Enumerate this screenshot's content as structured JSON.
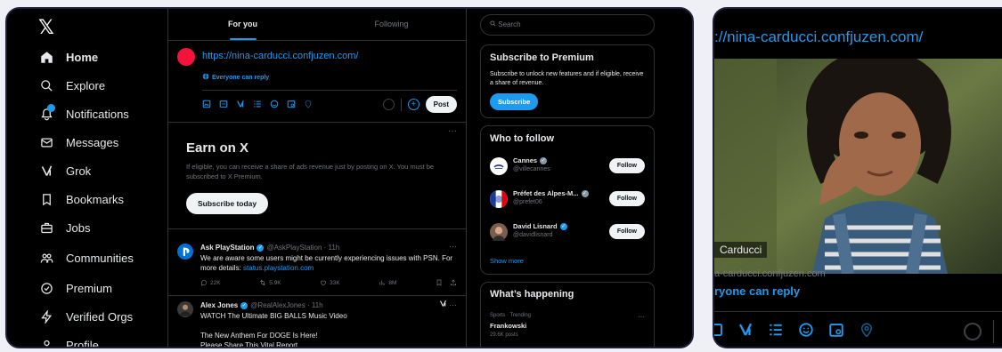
{
  "sidebar": {
    "logo": "𝕏",
    "items": [
      {
        "label": "Home",
        "icon": "home-icon"
      },
      {
        "label": "Explore",
        "icon": "search-icon"
      },
      {
        "label": "Notifications",
        "icon": "bell-icon"
      },
      {
        "label": "Messages",
        "icon": "envelope-icon"
      },
      {
        "label": "Grok",
        "icon": "grok-icon"
      },
      {
        "label": "Bookmarks",
        "icon": "bookmark-icon"
      },
      {
        "label": "Jobs",
        "icon": "briefcase-icon"
      },
      {
        "label": "Communities",
        "icon": "people-icon"
      },
      {
        "label": "Premium",
        "icon": "premium-icon"
      },
      {
        "label": "Verified Orgs",
        "icon": "lightning-icon"
      },
      {
        "label": "Profile",
        "icon": "person-icon"
      }
    ]
  },
  "tabs": [
    {
      "label": "For you"
    },
    {
      "label": "Following"
    }
  ],
  "composer": {
    "text": "https://nina-carducci.confjuzen.com/",
    "reply_setting": "Everyone can reply",
    "post_label": "Post"
  },
  "earn": {
    "title": "Earn on X",
    "description": "If eligible, you can receive a share of ads revenue just by posting on X. You must be subscribed to X Premium.",
    "button": "Subscribe today"
  },
  "tweets": [
    {
      "name": "Ask PlayStation",
      "meta": "@AskPlayStation · 11h",
      "body": "We are aware some users might be currently experiencing issues with PSN. For more details: ",
      "link": "status.playstation.com",
      "replies": "22K",
      "reposts": "5.9K",
      "likes": "33K",
      "views": "8M"
    },
    {
      "name": "Alex Jones",
      "meta": "@RealAlexJones · 11h",
      "line1": "WATCH The Ultimate BIG BALLS Music Video",
      "line2": "The New Anthem For DOGE Is Here!",
      "line3": "Please Share This Vital Report"
    }
  ],
  "search": {
    "placeholder": "Search"
  },
  "premium": {
    "title": "Subscribe to Premium",
    "description": "Subscribe to unlock new features and if eligible, receive a share of revenue.",
    "button": "Subscribe"
  },
  "who_to_follow": {
    "title": "Who to follow",
    "accounts": [
      {
        "name": "Cannes",
        "handle": "@villecannes",
        "button": "Follow"
      },
      {
        "name": "Préfet des Alpes-M...",
        "handle": "@prefet06",
        "button": "Follow"
      },
      {
        "name": "David Lisnard",
        "handle": "@davidlisnard",
        "button": "Follow"
      }
    ],
    "show_more": "Show more"
  },
  "happening": {
    "title": "What’s happening",
    "category": "Sports · Trending",
    "name": "Frankowski",
    "count": "29.6K posts"
  },
  "zoom": {
    "url": "://nina-carducci.confjuzen.com/",
    "caption": "Carducci",
    "domain": "a-carducci.confjuzen.com",
    "reply": "ryone can reply"
  },
  "colors": {
    "accent": "#1d9bf0",
    "background": "#000000",
    "border": "#2f3336"
  }
}
